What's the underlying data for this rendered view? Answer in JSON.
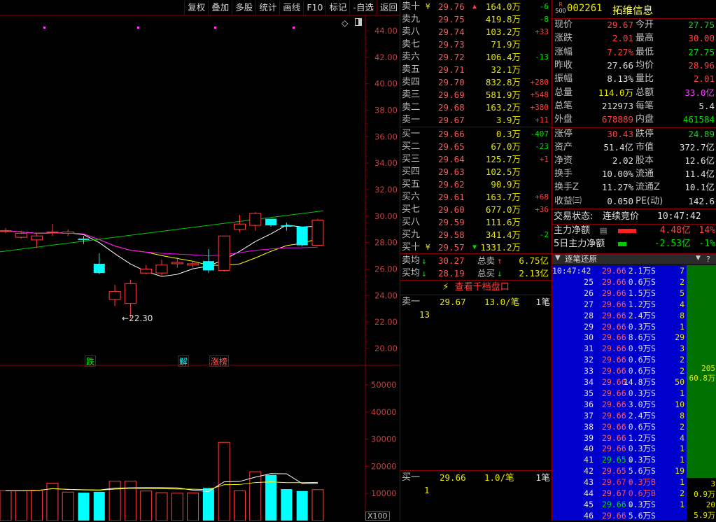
{
  "toolbar": [
    "复权",
    "叠加",
    "多股",
    "统计",
    "画线",
    "F10",
    "标记",
    "-自选",
    "返回"
  ],
  "chart_data": {
    "type": "candlestick",
    "price_axis": {
      "ticks": [
        "44.00",
        "42.00",
        "40.00",
        "38.00",
        "36.00",
        "34.00",
        "32.00",
        "30.00",
        "28.00",
        "26.00",
        "24.00",
        "22.00",
        "20.00"
      ],
      "ylim": [
        20,
        44
      ]
    },
    "volume_axis": {
      "ticks": [
        "50000",
        "40000",
        "30000",
        "20000",
        "10000"
      ],
      "unit": "X100"
    },
    "low_annotation": "22.30",
    "marks": [
      {
        "text": "跌"
      },
      {
        "text": "解"
      },
      {
        "text": "涨榜"
      }
    ],
    "candles": [
      {
        "o": 28.9,
        "c": 28.9,
        "h": 29.1,
        "l": 28.7,
        "v": 11000
      },
      {
        "o": 28.4,
        "c": 28.7,
        "h": 28.9,
        "l": 28.3,
        "v": 11000
      },
      {
        "o": 28.2,
        "c": 28.5,
        "h": 28.7,
        "l": 27.6,
        "v": 11200
      },
      {
        "o": 28.8,
        "c": 28.8,
        "h": 29.4,
        "l": 28.5,
        "v": 13800
      },
      {
        "o": 28.7,
        "c": 28.8,
        "h": 29.0,
        "l": 28.5,
        "v": 10500
      },
      {
        "o": 28.3,
        "c": 28.2,
        "h": 28.5,
        "l": 27.9,
        "v": 10300
      },
      {
        "o": 26.4,
        "c": 25.7,
        "h": 27.2,
        "l": 25.6,
        "v": 10600
      },
      {
        "o": 23.7,
        "c": 24.3,
        "h": 24.8,
        "l": 23.2,
        "v": 14500
      },
      {
        "o": 23.4,
        "c": 24.9,
        "h": 25.2,
        "l": 22.3,
        "v": 14500
      },
      {
        "o": 25.7,
        "c": 26.0,
        "h": 26.3,
        "l": 25.6,
        "v": 10900
      },
      {
        "o": 25.7,
        "c": 26.3,
        "h": 26.7,
        "l": 25.4,
        "v": 10300
      },
      {
        "o": 26.4,
        "c": 26.5,
        "h": 26.9,
        "l": 26.1,
        "v": 10100
      },
      {
        "o": 26.3,
        "c": 26.4,
        "h": 26.6,
        "l": 26.1,
        "v": 10200
      },
      {
        "o": 26.6,
        "c": 25.9,
        "h": 27.5,
        "l": 25.7,
        "v": 12000
      },
      {
        "o": 25.9,
        "c": 28.5,
        "h": 28.5,
        "l": 25.8,
        "v": 28800
      },
      {
        "o": 29.0,
        "c": 29.4,
        "h": 30.1,
        "l": 28.8,
        "v": 11000
      },
      {
        "o": 29.3,
        "c": 30.2,
        "h": 30.3,
        "l": 28.9,
        "v": 18000
      },
      {
        "o": 29.8,
        "c": 29.3,
        "h": 29.8,
        "l": 29.2,
        "v": 16800
      },
      {
        "o": 29.3,
        "c": 29.2,
        "h": 29.5,
        "l": 28.9,
        "v": 11600
      },
      {
        "o": 29.2,
        "c": 27.8,
        "h": 29.2,
        "l": 27.7,
        "v": 10900
      },
      {
        "o": 27.8,
        "c": 29.7,
        "h": 29.8,
        "l": 27.8,
        "v": 11400
      }
    ]
  },
  "orderbook": {
    "asks": [
      {
        "label": "卖十",
        "price": "29.76",
        "vol": "164.0万",
        "chg": "-6",
        "flag": "¥",
        "arrow": "up"
      },
      {
        "label": "卖九",
        "price": "29.75",
        "vol": "419.8万",
        "chg": "-8"
      },
      {
        "label": "卖八",
        "price": "29.74",
        "vol": "103.2万",
        "chg": "+33"
      },
      {
        "label": "卖七",
        "price": "29.73",
        "vol": "71.9万",
        "chg": ""
      },
      {
        "label": "卖六",
        "price": "29.72",
        "vol": "106.4万",
        "chg": "-13"
      },
      {
        "label": "卖五",
        "price": "29.71",
        "vol": "32.1万",
        "chg": ""
      },
      {
        "label": "卖四",
        "price": "29.70",
        "vol": "832.8万",
        "chg": "+280"
      },
      {
        "label": "卖三",
        "price": "29.69",
        "vol": "581.9万",
        "chg": "+548"
      },
      {
        "label": "卖二",
        "price": "29.68",
        "vol": "163.2万",
        "chg": "+380"
      },
      {
        "label": "卖一",
        "price": "29.67",
        "vol": "3.9万",
        "chg": "+11"
      }
    ],
    "bids": [
      {
        "label": "买一",
        "price": "29.66",
        "vol": "0.3万",
        "chg": "-407"
      },
      {
        "label": "买二",
        "price": "29.65",
        "vol": "67.0万",
        "chg": "-23"
      },
      {
        "label": "买三",
        "price": "29.64",
        "vol": "125.7万",
        "chg": "+1"
      },
      {
        "label": "买四",
        "price": "29.63",
        "vol": "102.5万",
        "chg": ""
      },
      {
        "label": "买五",
        "price": "29.62",
        "vol": "90.9万",
        "chg": ""
      },
      {
        "label": "买六",
        "price": "29.61",
        "vol": "163.7万",
        "chg": "+68"
      },
      {
        "label": "买七",
        "price": "29.60",
        "vol": "677.0万",
        "chg": "+36"
      },
      {
        "label": "买八",
        "price": "29.59",
        "vol": "111.6万",
        "chg": ""
      },
      {
        "label": "买九",
        "price": "29.58",
        "vol": "341.4万",
        "chg": "-2"
      },
      {
        "label": "买十",
        "price": "29.57",
        "vol": "1331.2万",
        "chg": "",
        "flag": "¥",
        "arrow": "dn"
      }
    ],
    "avg_sell": {
      "label": "卖均",
      "price": "30.27",
      "tlabel": "总卖",
      "total": "6.75亿"
    },
    "avg_buy": {
      "label": "买均",
      "price": "28.19",
      "tlabel": "总买",
      "total": "2.13亿"
    },
    "view_button": "查看千档盘口",
    "queue_sell": {
      "label": "卖一",
      "price": "29.67",
      "qty": "13.0/笔",
      "count": "1笔",
      "first": "13"
    },
    "queue_buy": {
      "label": "买一",
      "price": "29.66",
      "qty": "1.0/笔",
      "count": "1笔",
      "first": "1"
    }
  },
  "quote": {
    "badge_top": "R",
    "badge_bottom": "500",
    "code": "002261",
    "name": "拓维信息",
    "rows1": [
      {
        "l1": "现价",
        "v1": "29.67",
        "c1": "up",
        "l2": "今开",
        "v2": "27.75",
        "c2": "dn"
      },
      {
        "l1": "涨跌",
        "v1": "2.01",
        "c1": "up",
        "l2": "最高",
        "v2": "30.00",
        "c2": "up"
      },
      {
        "l1": "涨幅",
        "v1": "7.27%",
        "c1": "up",
        "l2": "最低",
        "v2": "27.75",
        "c2": "dn"
      },
      {
        "l1": "昨收",
        "v1": "27.66",
        "c1": "wht",
        "l2": "均价",
        "v2": "28.96",
        "c2": "up"
      },
      {
        "l1": "振幅",
        "v1": "8.13%",
        "c1": "wht",
        "l2": "量比",
        "v2": "2.01",
        "c2": "up"
      },
      {
        "l1": "总量",
        "v1": "114.0万",
        "c1": "yel",
        "l2": "总额",
        "v2": "33.0亿",
        "c2": "mag"
      },
      {
        "l1": "总笔",
        "v1": "212973",
        "c1": "wht",
        "l2": "每笔",
        "v2": "5.4",
        "c2": "wht"
      },
      {
        "l1": "外盘",
        "v1": "678889",
        "c1": "up",
        "l2": "内盘",
        "v2": "461584",
        "c2": "dn"
      }
    ],
    "rows2": [
      {
        "l1": "涨停",
        "v1": "30.43",
        "c1": "up",
        "l2": "跌停",
        "v2": "24.89",
        "c2": "dn"
      },
      {
        "l1": "资产",
        "v1": "51.4亿",
        "c1": "wht",
        "l2": "市值",
        "v2": "372.7亿",
        "c2": "wht"
      },
      {
        "l1": "净资",
        "v1": "2.02",
        "c1": "wht",
        "l2": "股本",
        "v2": "12.6亿",
        "c2": "wht"
      },
      {
        "l1": "换手",
        "v1": "10.00%",
        "c1": "wht",
        "l2": "流通",
        "v2": "11.4亿",
        "c2": "wht"
      },
      {
        "l1": "换手Z",
        "v1": "11.27%",
        "c1": "wht",
        "l2": "流通Z",
        "v2": "10.1亿",
        "c2": "wht"
      },
      {
        "l1": "收益㈢",
        "v1": "0.050",
        "c1": "wht",
        "l2": "PE(动)",
        "v2": "142.6",
        "c2": "wht"
      }
    ],
    "status_label": "交易状态:",
    "status_value": "连续竞价",
    "status_time": "10:47:42",
    "main_flow_label": "主力净额",
    "main_flow_value": "4.48亿",
    "main_flow_pct": "14%",
    "main_flow5_label": "5日主力净额",
    "main_flow5_value": "-2.53亿",
    "main_flow5_pct": "-1%",
    "tick_panel_title": "逐笔还原",
    "tick_help": "?",
    "ticks": [
      {
        "t": "10:47:42",
        "p": "29.66",
        "v": "2.1万",
        "s": "S",
        "n": "7",
        "pc": "wht"
      },
      {
        "t": "25",
        "p": "29.66",
        "v": "0.6万",
        "s": "S",
        "n": "2",
        "pc": "wht"
      },
      {
        "t": "26",
        "p": "29.66",
        "v": "1.5万",
        "s": "S",
        "n": "5",
        "pc": "wht"
      },
      {
        "t": "27",
        "p": "29.66",
        "v": "1.2万",
        "s": "S",
        "n": "4",
        "pc": "wht"
      },
      {
        "t": "28",
        "p": "29.66",
        "v": "2.4万",
        "s": "S",
        "n": "8",
        "pc": "wht"
      },
      {
        "t": "29",
        "p": "29.66",
        "v": "0.3万",
        "s": "S",
        "n": "1",
        "pc": "wht"
      },
      {
        "t": "30",
        "p": "29.66",
        "v": "8.6万",
        "s": "S",
        "n": "29",
        "pc": "wht"
      },
      {
        "t": "31",
        "p": "29.66",
        "v": "0.9万",
        "s": "S",
        "n": "3",
        "pc": "wht"
      },
      {
        "t": "32",
        "p": "29.66",
        "v": "0.6万",
        "s": "S",
        "n": "2",
        "pc": "wht"
      },
      {
        "t": "33",
        "p": "29.66",
        "v": "0.6万",
        "s": "S",
        "n": "2",
        "pc": "wht"
      },
      {
        "t": "34",
        "p": "29.66",
        "v": "14.8万",
        "s": "S",
        "n": "50",
        "pc": "wht"
      },
      {
        "t": "35",
        "p": "29.66",
        "v": "0.3万",
        "s": "S",
        "n": "1",
        "pc": "wht"
      },
      {
        "t": "36",
        "p": "29.66",
        "v": "3.0万",
        "s": "S",
        "n": "10",
        "pc": "wht"
      },
      {
        "t": "37",
        "p": "29.66",
        "v": "2.4万",
        "s": "S",
        "n": "8",
        "pc": "wht"
      },
      {
        "t": "38",
        "p": "29.66",
        "v": "0.6万",
        "s": "S",
        "n": "2",
        "pc": "wht"
      },
      {
        "t": "39",
        "p": "29.66",
        "v": "1.2万",
        "s": "S",
        "n": "4",
        "pc": "wht"
      },
      {
        "t": "40",
        "p": "29.66",
        "v": "0.3万",
        "s": "S",
        "n": "1",
        "pc": "wht"
      },
      {
        "t": "41",
        "p": "29.65",
        "v": "0.3万",
        "s": "S",
        "n": "1",
        "pc": "dn",
        "arrow": "dn"
      },
      {
        "t": "42",
        "p": "29.65",
        "v": "5.6万",
        "s": "S",
        "n": "19",
        "pc": "wht"
      },
      {
        "t": "43",
        "p": "29.67",
        "v": "0.3万",
        "s": "B",
        "n": "1",
        "pc": "up",
        "arrow": "up"
      },
      {
        "t": "44",
        "p": "29.67",
        "v": "0.6万",
        "s": "B",
        "n": "2",
        "pc": "wht"
      },
      {
        "t": "45",
        "p": "29.66",
        "v": "0.3万",
        "s": "S",
        "n": "1",
        "pc": "dn",
        "arrow": "dn"
      },
      {
        "t": "46",
        "p": "29.66",
        "v": "5.6万",
        "s": "S",
        "n": "",
        "pc": "wht"
      }
    ],
    "side_green_n": "205",
    "side_green_v": "60.8万",
    "side_b_n1": "3",
    "side_b_v1": "0.9万",
    "side_b_n2": "20",
    "side_b_v2": "5.9万"
  },
  "colors": {
    "up": "#ff4040",
    "down": "#00ffff",
    "ma5": "#ffffff",
    "ma10": "#ffff00",
    "ma20": "#ff00ff",
    "trend": "#00cc00",
    "grid": "#8a0000"
  }
}
